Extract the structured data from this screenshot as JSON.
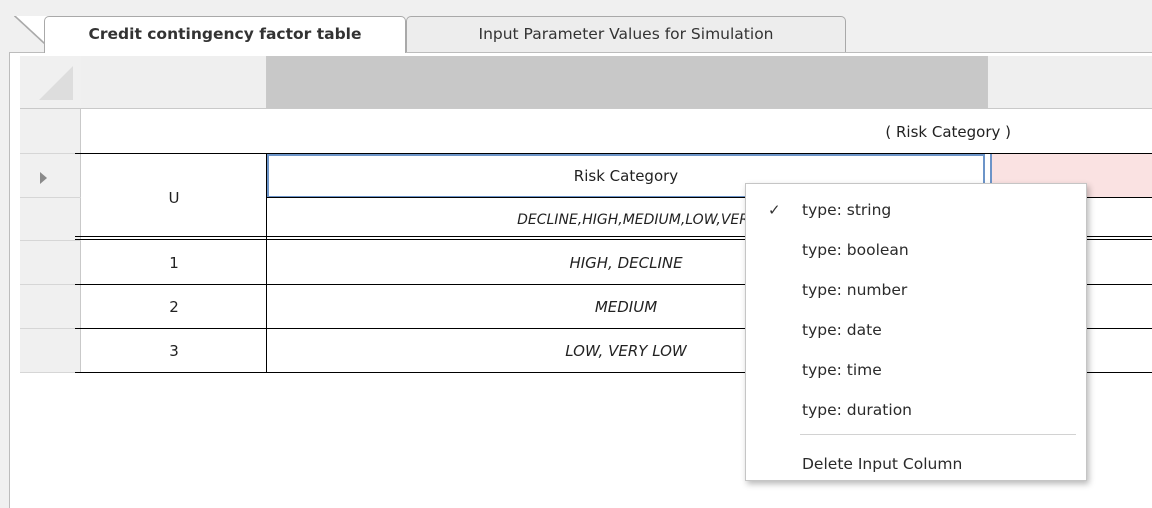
{
  "tabs": [
    {
      "label": "Credit contingency factor table",
      "active": true
    },
    {
      "label": "Input Parameter Values for Simulation",
      "active": false
    }
  ],
  "table": {
    "group_header": "( Risk Category )",
    "hit_policy": "U",
    "input_header": "Risk Category",
    "input_values": "DECLINE,HIGH,MEDIUM,LOW,VER",
    "rows": [
      {
        "number": "1",
        "value": "HIGH, DECLINE"
      },
      {
        "number": "2",
        "value": "MEDIUM"
      },
      {
        "number": "3",
        "value": "LOW, VERY LOW"
      }
    ]
  },
  "context_menu": {
    "items": [
      {
        "label": "type: string",
        "checked": true
      },
      {
        "label": "type: boolean",
        "checked": false
      },
      {
        "label": "type: number",
        "checked": false
      },
      {
        "label": "type: date",
        "checked": false
      },
      {
        "label": "type: time",
        "checked": false
      },
      {
        "label": "type: duration",
        "checked": false
      }
    ],
    "check_glyph": "✓",
    "delete_label": "Delete Input Column"
  },
  "colors": {
    "selection_border": "#6c94c8",
    "output_cell": "#fae2e2",
    "column_header_selected": "#c8c8c8"
  }
}
